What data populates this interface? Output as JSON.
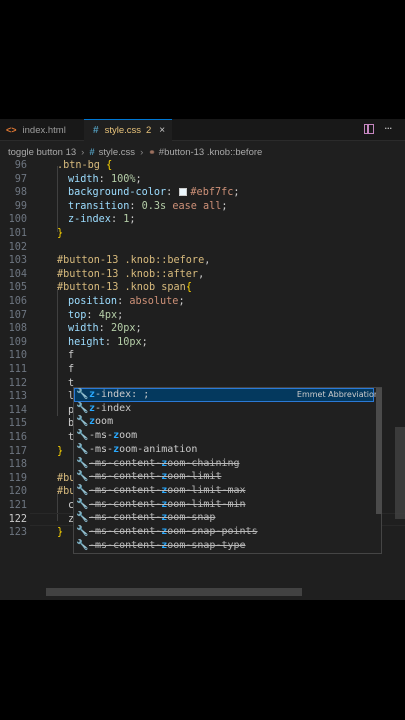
{
  "tabs": [
    {
      "icon": "<>",
      "label": "index.html"
    },
    {
      "icon": "#",
      "label": "style.css",
      "problems": "2",
      "close": "×"
    }
  ],
  "more_glyph": "···",
  "breadcrumb": {
    "folder": "toggle button 13",
    "file": "style.css",
    "selector_icon": "⚭",
    "selector": "#button-13 .knob::before"
  },
  "code_lines": [
    {
      "num": "96",
      "text": ".btn-bg {"
    },
    {
      "num": "97",
      "text": "width: 100%;"
    },
    {
      "num": "98",
      "text": "background-color: #ebf7fc;"
    },
    {
      "num": "99",
      "text": "transition: 0.3s ease all;"
    },
    {
      "num": "100",
      "text": "z-index: 1;"
    },
    {
      "num": "101",
      "text": "}"
    },
    {
      "num": "102",
      "text": ""
    },
    {
      "num": "103",
      "text": "#button-13 .knob::before,"
    },
    {
      "num": "104",
      "text": "#button-13 .knob::after,"
    },
    {
      "num": "105",
      "text": "#button-13 .knob span{"
    },
    {
      "num": "106",
      "text": "position: absolute;"
    },
    {
      "num": "107",
      "text": "top: 4px;"
    },
    {
      "num": "108",
      "text": "width: 20px;"
    },
    {
      "num": "109",
      "text": "height: 10px;"
    },
    {
      "num": "110",
      "text": "f"
    },
    {
      "num": "111",
      "text": "f"
    },
    {
      "num": "112",
      "text": "t"
    },
    {
      "num": "113",
      "text": "l"
    },
    {
      "num": "114",
      "text": "p"
    },
    {
      "num": "115",
      "text": "b"
    },
    {
      "num": "116",
      "text": "t"
    },
    {
      "num": "117",
      "text": "}"
    },
    {
      "num": "118",
      "text": ""
    },
    {
      "num": "119",
      "text": "#bu"
    },
    {
      "num": "120",
      "text": "#bu"
    },
    {
      "num": "121",
      "text": "c"
    },
    {
      "num": "122",
      "text": "z"
    },
    {
      "num": "123",
      "text": "}"
    }
  ],
  "suggestions": [
    {
      "label": "z-index: ;",
      "detail": "Emmet Abbreviation",
      "deprecated": false
    },
    {
      "label": "z-index",
      "deprecated": false
    },
    {
      "label": "zoom",
      "deprecated": false
    },
    {
      "label": "-ms-zoom",
      "deprecated": false
    },
    {
      "label": "-ms-zoom-animation",
      "deprecated": false
    },
    {
      "label": "-ms-content-zoom-chaining",
      "deprecated": true
    },
    {
      "label": "-ms-content-zoom-limit",
      "deprecated": true
    },
    {
      "label": "-ms-content-zoom-limit-max",
      "deprecated": true
    },
    {
      "label": "-ms-content-zoom-limit-min",
      "deprecated": true
    },
    {
      "label": "-ms-content-zoom-snap",
      "deprecated": true
    },
    {
      "label": "-ms-content-zoom-snap-points",
      "deprecated": true
    },
    {
      "label": "-ms-content-zoom-snap-type",
      "deprecated": true
    }
  ],
  "suggestion_icon": "wrench-icon",
  "colors": {
    "accent": "#0078d4",
    "selector": "#d7ba7d",
    "property": "#9cdcfe",
    "value": "#ce9178",
    "number": "#b5cea8",
    "highlight": "#2aaaff"
  }
}
